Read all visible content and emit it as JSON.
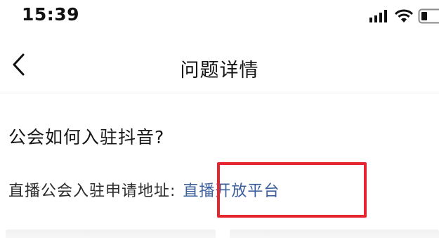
{
  "status_bar": {
    "time": "15:39",
    "icons": [
      "signal-icon",
      "wifi-icon",
      "battery-icon"
    ]
  },
  "nav": {
    "back_icon": "chevron-left-icon",
    "title": "问题详情"
  },
  "question": {
    "title": "公会如何入驻抖音?",
    "answer_label": "直播公会入驻申请地址:",
    "answer_link": "直播开放平台"
  },
  "colors": {
    "link": "#3a5f9b",
    "highlight_border": "#e5262f",
    "text": "#161616"
  }
}
